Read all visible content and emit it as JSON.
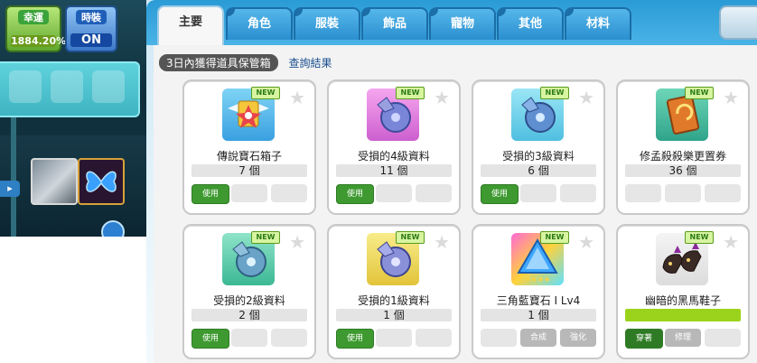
{
  "hud": {
    "luck_label": "幸運",
    "luck_value": "1884.20%",
    "fashion_label": "時裝",
    "fashion_value": "ON"
  },
  "tabs": [
    "主要",
    "角色",
    "服裝",
    "飾品",
    "寵物",
    "其他",
    "材料"
  ],
  "info": {
    "label": "3日內獲得道具保管箱",
    "link": "查詢結果"
  },
  "items": [
    {
      "name": "傳說寶石箱子",
      "qty": "7 個",
      "new": "NEW",
      "icon": "winged-gem-box-icon",
      "buttons": [
        "使用",
        "",
        ""
      ]
    },
    {
      "name": "受損的4級資料",
      "qty": "11 個",
      "new": "NEW",
      "icon": "disc-data-icon",
      "buttons": [
        "使用",
        "",
        ""
      ]
    },
    {
      "name": "受損的3級資料",
      "qty": "6 個",
      "new": "NEW",
      "icon": "disc-data-icon",
      "buttons": [
        "使用",
        "",
        ""
      ]
    },
    {
      "name": "修孟殺殺樂更置券",
      "qty": "36 個",
      "new": "NEW",
      "icon": "ticket-icon",
      "buttons": [
        "",
        "",
        ""
      ]
    },
    {
      "name": "受損的2級資料",
      "qty": "2 個",
      "new": "NEW",
      "icon": "disc-data-icon",
      "buttons": [
        "使用",
        "",
        ""
      ]
    },
    {
      "name": "受損的1級資料",
      "qty": "1 個",
      "new": "NEW",
      "icon": "disc-data-icon",
      "buttons": [
        "使用",
        "",
        ""
      ]
    },
    {
      "name": "三角藍寶石 I Lv4",
      "qty": "1 個",
      "new": "NEW",
      "icon": "triangle-sapphire-icon",
      "buttons": [
        "",
        "合成",
        "強化"
      ]
    },
    {
      "name": "幽暗的黑馬鞋子",
      "qty": "",
      "new": "NEW",
      "icon": "dark-horse-shoes-icon",
      "buttons": [
        "穿著",
        "修理",
        ""
      ]
    }
  ],
  "colors": {
    "tab_blue": "#2a9bd6",
    "new_green": "#5a9c1e",
    "use_green": "#3e9a30",
    "durability_green": "#9bd31c"
  }
}
